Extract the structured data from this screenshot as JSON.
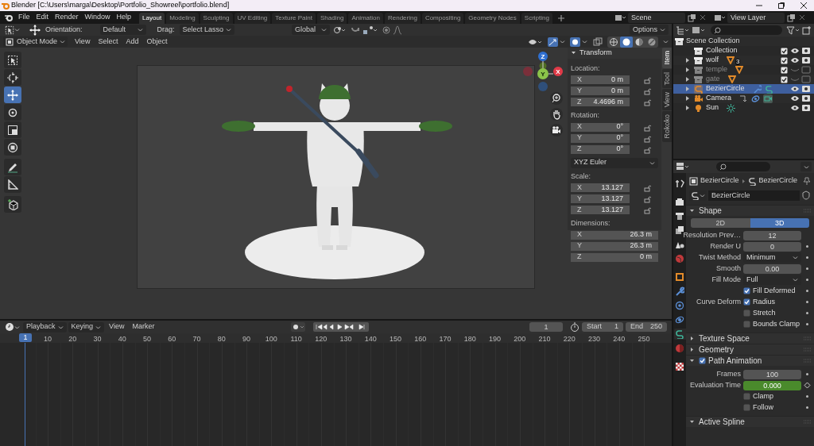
{
  "window": {
    "title": "Blender [C:\\Users\\marga\\Desktop\\Portfolio_Showreel\\portfolio.blend]"
  },
  "menu": [
    "File",
    "Edit",
    "Render",
    "Window",
    "Help"
  ],
  "workspaces": [
    {
      "label": "Layout",
      "selected": true
    },
    {
      "label": "Modeling",
      "selected": false
    },
    {
      "label": "Sculpting",
      "selected": false
    },
    {
      "label": "UV Editing",
      "selected": false
    },
    {
      "label": "Texture Paint",
      "selected": false
    },
    {
      "label": "Shading",
      "selected": false
    },
    {
      "label": "Animation",
      "selected": false
    },
    {
      "label": "Rendering",
      "selected": false
    },
    {
      "label": "Compositing",
      "selected": false
    },
    {
      "label": "Geometry Nodes",
      "selected": false
    },
    {
      "label": "Scripting",
      "selected": false
    }
  ],
  "scene": "Scene",
  "view_layer": "View Layer",
  "tool_settings": {
    "orientation_label": "Orientation:",
    "orientation": "Default",
    "drag_label": "Drag:",
    "drag": "Select Lasso",
    "transform_orientation": "Global",
    "options": "Options"
  },
  "viewport_header": {
    "mode": "Object Mode",
    "menus": [
      "View",
      "Select",
      "Add",
      "Object"
    ],
    "shading": [
      {
        "kind": "wireframe",
        "selected": false
      },
      {
        "kind": "solid",
        "selected": true
      },
      {
        "kind": "material",
        "selected": false
      },
      {
        "kind": "rendered",
        "selected": false
      }
    ]
  },
  "toolbar": [
    {
      "kind": "select",
      "selected": false
    },
    {
      "kind": "cursor",
      "selected": false
    },
    {
      "kind": "move",
      "selected": true
    },
    {
      "kind": "rotate",
      "selected": false
    },
    {
      "kind": "scale",
      "selected": false
    },
    {
      "kind": "transform",
      "selected": false
    },
    {
      "kind": "annotate",
      "selected": false
    },
    {
      "kind": "measure",
      "selected": false
    },
    {
      "kind": "add-cube",
      "selected": false
    }
  ],
  "gizmo": [
    "Z",
    "Y",
    "X"
  ],
  "sidebar": {
    "tabs": [
      {
        "label": "Item",
        "selected": true
      },
      {
        "label": "Tool",
        "selected": false
      },
      {
        "label": "View",
        "selected": false
      },
      {
        "label": "Rokoko",
        "selected": false
      }
    ],
    "panel": "Transform",
    "sections": [
      {
        "kind": "vector",
        "label": "Location:",
        "lockable": true,
        "fields": [
          {
            "axis": "X",
            "value": "0 m"
          },
          {
            "axis": "Y",
            "value": "0 m"
          },
          {
            "axis": "Z",
            "value": "4.4696 m"
          }
        ]
      },
      {
        "kind": "vector",
        "label": "Rotation:",
        "lockable": true,
        "fields": [
          {
            "axis": "X",
            "value": "0°"
          },
          {
            "axis": "Y",
            "value": "0°"
          },
          {
            "axis": "Z",
            "value": "0°"
          }
        ]
      },
      {
        "kind": "dropdown",
        "value": "XYZ Euler"
      },
      {
        "kind": "vector",
        "label": "Scale:",
        "lockable": true,
        "fields": [
          {
            "axis": "X",
            "value": "13.127"
          },
          {
            "axis": "Y",
            "value": "13.127"
          },
          {
            "axis": "Z",
            "value": "13.127"
          }
        ]
      },
      {
        "kind": "vector",
        "label": "Dimensions:",
        "lockable": false,
        "fields": [
          {
            "axis": "X",
            "value": "26.3 m"
          },
          {
            "axis": "Y",
            "value": "26.3 m"
          },
          {
            "axis": "Z",
            "value": "0 m"
          }
        ]
      }
    ]
  },
  "timeline": {
    "menus": [
      "Playback",
      "Keying",
      "View",
      "Marker"
    ],
    "current_frame": "1",
    "start_label": "Start",
    "start": "1",
    "end_label": "End",
    "end": "250",
    "playhead": "1",
    "ticks": [
      "10",
      "20",
      "30",
      "40",
      "50",
      "60",
      "70",
      "80",
      "90",
      "100",
      "110",
      "120",
      "130",
      "140",
      "150",
      "160",
      "170",
      "180",
      "190",
      "200",
      "210",
      "220",
      "230",
      "240",
      "250"
    ]
  },
  "outliner": {
    "root": "Scene Collection",
    "children": [
      {
        "name": "Collection",
        "kind": "collection",
        "expandable": false,
        "checked": true,
        "hidden": false,
        "selected": false
      },
      {
        "name": "wolf",
        "kind": "mesh-collection",
        "count": "3",
        "expandable": true,
        "checked": true,
        "hidden": false,
        "selected": false
      },
      {
        "name": "temple",
        "kind": "mesh-collection",
        "expandable": true,
        "checked": true,
        "hidden": true,
        "selected": false
      },
      {
        "name": "gate",
        "kind": "mesh-collection",
        "expandable": true,
        "checked": true,
        "hidden": true,
        "selected": false
      },
      {
        "name": "BezierCircle",
        "kind": "curve",
        "expandable": true,
        "hidden": false,
        "selected": true
      },
      {
        "name": "Camera",
        "kind": "camera",
        "expandable": true,
        "hidden": false,
        "selected": false
      },
      {
        "name": "Sun",
        "kind": "light",
        "expandable": true,
        "hidden": false,
        "selected": false
      }
    ]
  },
  "properties": {
    "tabs": [
      {
        "kind": "tool",
        "selected": false
      },
      {
        "kind": "render",
        "selected": false
      },
      {
        "kind": "output",
        "selected": false
      },
      {
        "kind": "view-layer",
        "selected": false
      },
      {
        "kind": "scene",
        "selected": false
      },
      {
        "kind": "world",
        "selected": false
      },
      {
        "kind": "object",
        "selected": false
      },
      {
        "kind": "modifiers",
        "selected": false
      },
      {
        "kind": "particles",
        "selected": false
      },
      {
        "kind": "physics",
        "selected": false
      },
      {
        "kind": "data",
        "selected": true
      },
      {
        "kind": "material",
        "selected": false
      },
      {
        "kind": "texture",
        "selected": false
      }
    ],
    "object": "BezierCircle",
    "data": "BezierCircle",
    "datablock": "BezierCircle",
    "panels": [
      {
        "title": "Shape",
        "expanded": true,
        "rows": [
          {
            "kind": "toggle",
            "options": [
              {
                "label": "2D",
                "selected": false
              },
              {
                "label": "3D",
                "selected": true
              }
            ]
          },
          {
            "kind": "number",
            "label": "Resolution Prev…",
            "value": "12"
          },
          {
            "kind": "number",
            "label": "Render U",
            "value": "0",
            "animatable": true
          },
          {
            "kind": "dropdown",
            "label": "Twist Method",
            "value": "Minimum",
            "animatable": true
          },
          {
            "kind": "number",
            "label": "Smooth",
            "value": "0.00",
            "animatable": true
          },
          {
            "kind": "dropdown",
            "label": "Fill Mode",
            "value": "Full",
            "animatable": true
          },
          {
            "kind": "checkbox",
            "text": "Fill Deformed",
            "checked": true,
            "animatable": true
          },
          {
            "kind": "checkbox",
            "label": "Curve Deform",
            "text": "Radius",
            "checked": true,
            "animatable": true
          },
          {
            "kind": "checkbox",
            "text": "Stretch",
            "checked": false,
            "animatable": true
          },
          {
            "kind": "checkbox",
            "text": "Bounds Clamp",
            "checked": false,
            "animatable": true
          }
        ]
      },
      {
        "title": "Texture Space",
        "expanded": false
      },
      {
        "title": "Geometry",
        "expanded": false
      },
      {
        "title": "Path Animation",
        "expanded": true,
        "checked": true,
        "rows": [
          {
            "kind": "number",
            "label": "Frames",
            "value": "100",
            "animatable": true
          },
          {
            "kind": "number",
            "label": "Evaluation Time",
            "value": "0.000",
            "animated": true,
            "animatable": true
          },
          {
            "kind": "checkbox",
            "text": "Clamp",
            "checked": false,
            "animatable": true
          },
          {
            "kind": "checkbox",
            "text": "Follow",
            "checked": false,
            "animatable": true
          }
        ]
      },
      {
        "title": "Active Spline",
        "expanded": true
      }
    ]
  }
}
